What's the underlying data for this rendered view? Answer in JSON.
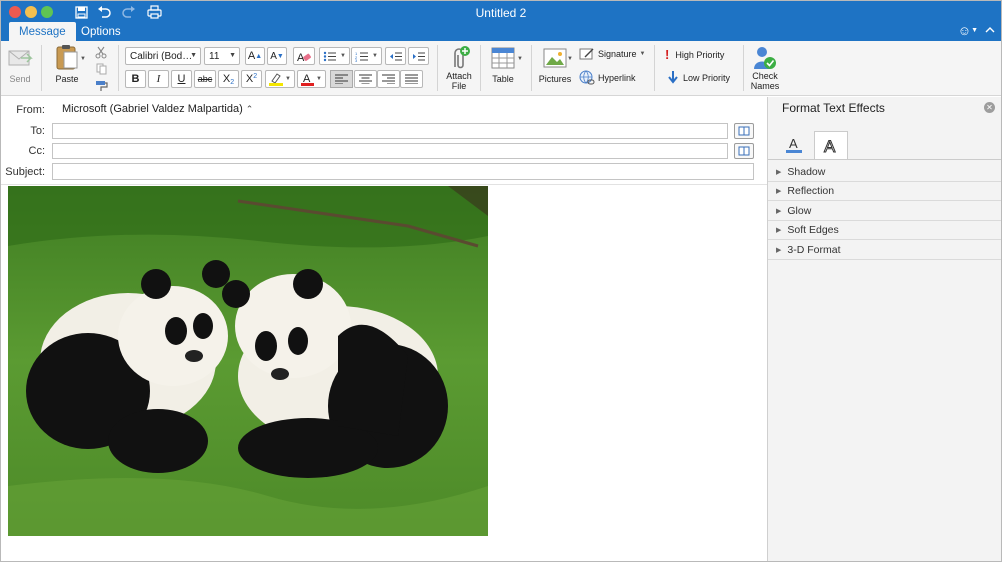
{
  "window": {
    "title": "Untitled 2"
  },
  "tabs": [
    {
      "label": "Message"
    },
    {
      "label": "Options"
    }
  ],
  "ribbon": {
    "send": "Send",
    "paste": "Paste",
    "font_name": "Calibri (Bod…",
    "font_size": "11",
    "bold": "B",
    "italic": "I",
    "underline": "U",
    "strikethrough": "abc",
    "subscript": "X",
    "subscript_mark": "2",
    "superscript": "X",
    "superscript_mark": "2",
    "attach_file": "Attach File",
    "table": "Table",
    "pictures": "Pictures",
    "signature": "Signature",
    "hyperlink": "Hyperlink",
    "high_priority": "High Priority",
    "low_priority": "Low Priority",
    "check_names": "Check Names"
  },
  "compose": {
    "from_label": "From:",
    "from_value": "Microsoft (Gabriel Valdez Malpartida)",
    "to_label": "To:",
    "to_value": "",
    "cc_label": "Cc:",
    "cc_value": "",
    "subject_label": "Subject:",
    "subject_value": "",
    "body_image": "two giant panda cubs sitting on grass"
  },
  "pane": {
    "title": "Format Text Effects",
    "sections": [
      {
        "label": "Shadow"
      },
      {
        "label": "Reflection"
      },
      {
        "label": "Glow"
      },
      {
        "label": "Soft Edges"
      },
      {
        "label": "3-D Format"
      }
    ]
  },
  "colors": {
    "titlebar": "#1e73c4",
    "ribbon": "#f5f5f5",
    "highlight": "#f4e600",
    "font_color": "#e02020",
    "pane_bg": "#f3f3f3"
  }
}
